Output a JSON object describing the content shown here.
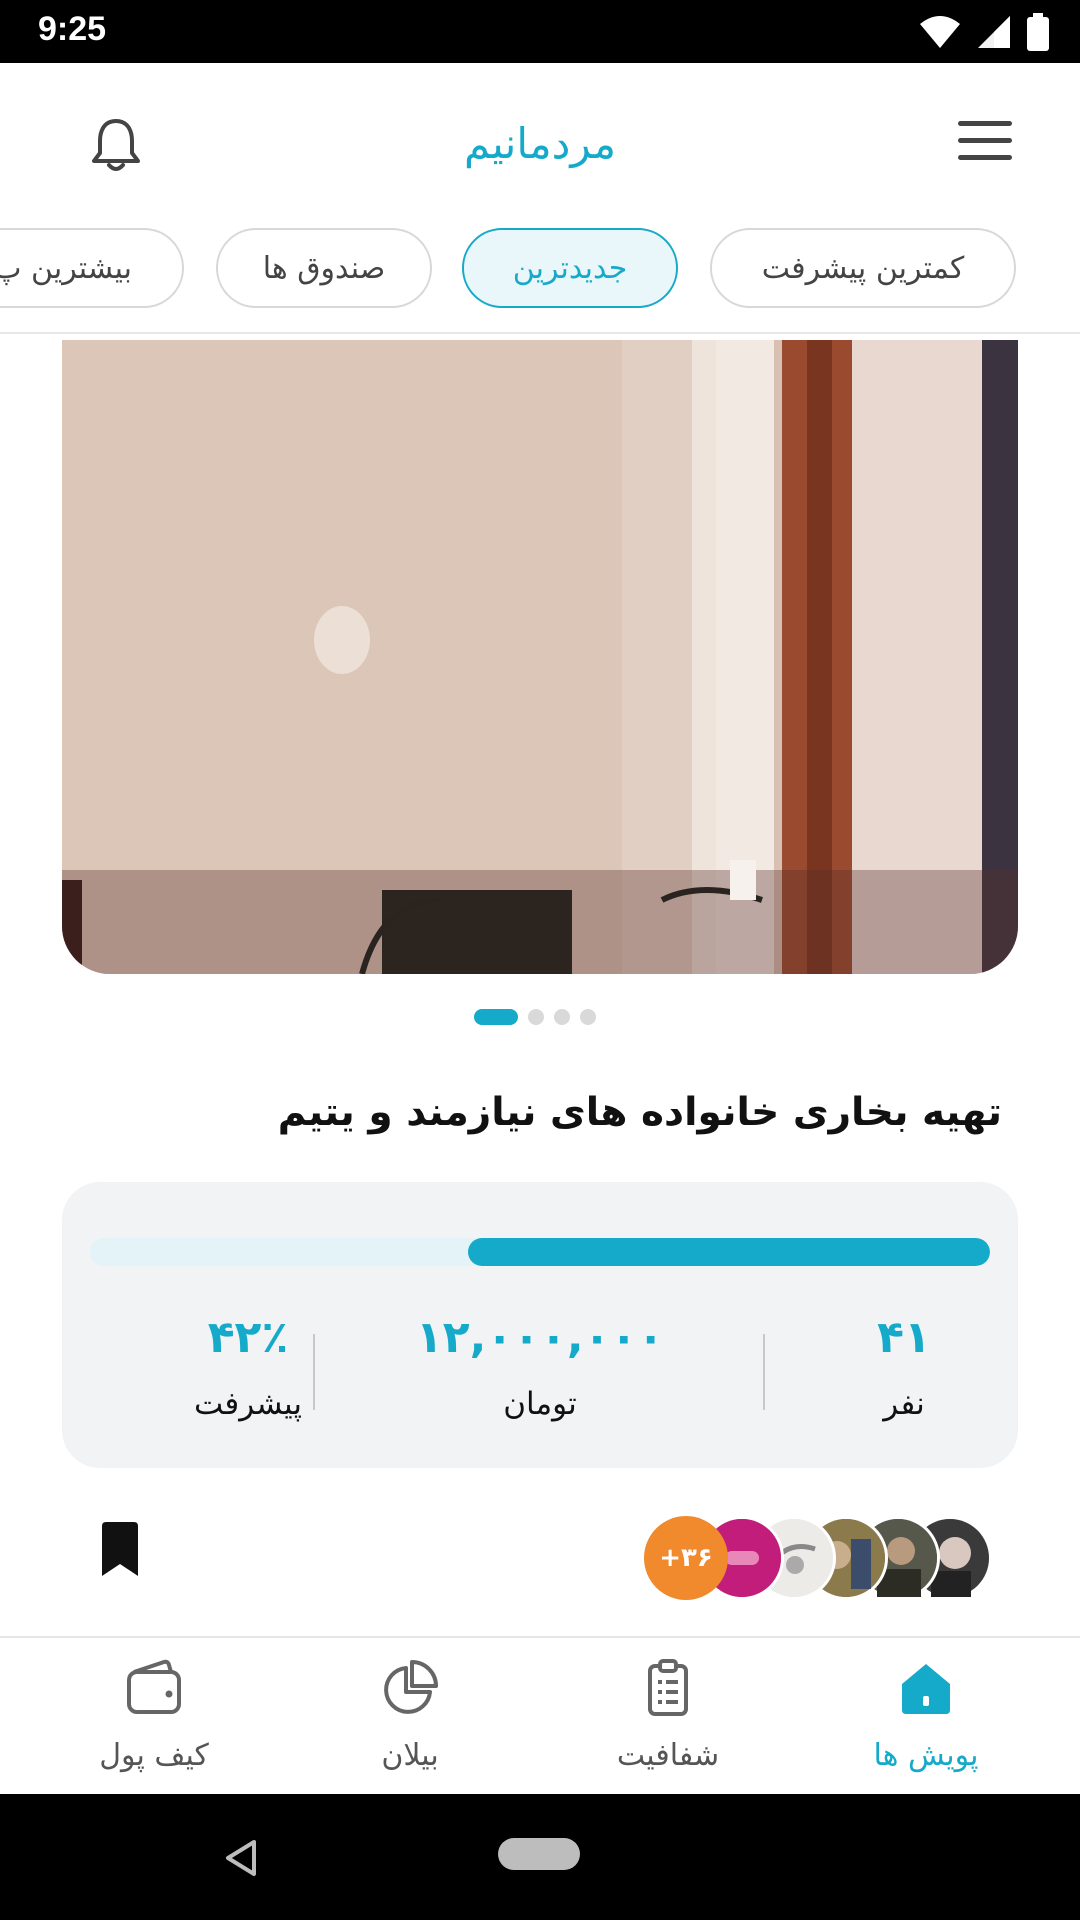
{
  "status_bar": {
    "time": "9:25"
  },
  "header": {
    "logo_text": "مردمانیم"
  },
  "chips": [
    {
      "label": "کمترین پیشرفت",
      "active": false
    },
    {
      "label": "جدیدترین",
      "active": true
    },
    {
      "label": "صندوق ها",
      "active": false
    },
    {
      "label": "بیشترین پ",
      "active": false
    }
  ],
  "carousel": {
    "page_count": 4,
    "active_index": 0
  },
  "campaign": {
    "title": "تهیه بخاری خانواده های نیازمند و یتیم",
    "progress_fraction": 0.58,
    "stats": {
      "people_value": "۴۱",
      "people_label": "نفر",
      "amount_value": "۱۲,۰۰۰,۰۰۰",
      "amount_label": "تومان",
      "percent_value": "۴۲٪",
      "percent_label": "پیشرفت"
    },
    "donors_more": "+۳۶"
  },
  "nav": {
    "items": [
      {
        "label": "کیف پول",
        "icon": "wallet-icon",
        "active": false
      },
      {
        "label": "بیلان",
        "icon": "pie-chart-icon",
        "active": false
      },
      {
        "label": "شفافیت",
        "icon": "clipboard-icon",
        "active": false
      },
      {
        "label": "پویش ها",
        "icon": "home-icon",
        "active": true
      }
    ]
  },
  "colors": {
    "accent": "#15aac9",
    "orange": "#f08a2d",
    "magenta": "#c21d7a"
  }
}
